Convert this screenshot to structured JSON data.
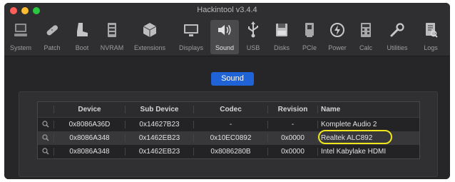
{
  "window": {
    "title": "Hackintool v3.4.4"
  },
  "toolbar": {
    "items": [
      {
        "label": "System",
        "icon": "computer-icon"
      },
      {
        "label": "Patch",
        "icon": "bandage-icon"
      },
      {
        "label": "Boot",
        "icon": "boot-icon"
      },
      {
        "label": "NVRAM",
        "icon": "nvram-icon"
      },
      {
        "label": "Extensions",
        "icon": "extensions-box-icon"
      },
      {
        "label": "Displays",
        "icon": "display-icon"
      },
      {
        "label": "Sound",
        "icon": "speaker-icon"
      },
      {
        "label": "USB",
        "icon": "usb-icon"
      },
      {
        "label": "Disks",
        "icon": "disk-icon"
      },
      {
        "label": "PCIe",
        "icon": "pcie-card-icon"
      },
      {
        "label": "Power",
        "icon": "power-icon"
      },
      {
        "label": "Calc",
        "icon": "calculator-icon"
      },
      {
        "label": "Utilities",
        "icon": "wrench-icon"
      },
      {
        "label": "Logs",
        "icon": "logs-icon"
      }
    ],
    "active": "Sound"
  },
  "segment": {
    "label": "Sound"
  },
  "table": {
    "columns": [
      "Device",
      "Sub Device",
      "Codec",
      "Revision",
      "Name"
    ],
    "rows": [
      {
        "device": "0x8086A36D",
        "sub_device": "0x14627B23",
        "codec": "-",
        "revision": "-",
        "name": "Komplete Audio 2"
      },
      {
        "device": "0x8086A348",
        "sub_device": "0x1462EB23",
        "codec": "0x10EC0892",
        "revision": "0x0000",
        "name": "Realtek ALC892"
      },
      {
        "device": "0x8086A348",
        "sub_device": "0x1462EB23",
        "codec": "0x8086280B",
        "revision": "0x0000",
        "name": "Intel Kabylake HDMI"
      }
    ]
  },
  "colors": {
    "accent": "#1f63d6",
    "highlight": "#f2e51c"
  }
}
